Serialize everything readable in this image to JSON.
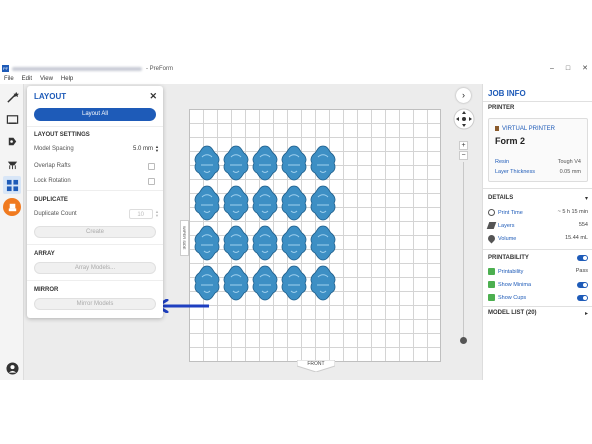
{
  "window": {
    "logo": "PF",
    "title": "- PreForm",
    "controls": [
      "–",
      "□",
      "✕"
    ]
  },
  "menu": [
    "File",
    "Edit",
    "View",
    "Help"
  ],
  "toolbar": {
    "tools": [
      "magic-wand-icon",
      "select-icon",
      "orient-icon",
      "supports-icon",
      "layout-icon",
      "print-icon",
      "account-icon"
    ]
  },
  "layout_panel": {
    "title": "LAYOUT",
    "close": "✕",
    "layout_all": "Layout All",
    "settings_heading": "LAYOUT SETTINGS",
    "model_spacing_label": "Model Spacing",
    "model_spacing_value": "5.0 mm",
    "overlap_rafts_label": "Overlap Rafts",
    "lock_rotation_label": "Lock Rotation",
    "duplicate_heading": "DUPLICATE",
    "duplicate_count_label": "Duplicate Count",
    "duplicate_count_value": "10",
    "create_label": "Create",
    "array_heading": "ARRAY",
    "array_models_label": "Array Models...",
    "mirror_heading": "MIRROR",
    "mirror_models_label": "Mirror Models"
  },
  "build_plate": {
    "wiper_label": "WIPER SIDE",
    "front_label": "FRONT",
    "model_rows": 4,
    "model_cols": 5,
    "model_color": "#3d8fc4"
  },
  "view_controls": {
    "next": "›",
    "zoom_in": "+",
    "zoom_out": "−",
    "zoom_level": 0
  },
  "job_info": {
    "title": "JOB INFO",
    "printer_heading": "PRINTER",
    "printer_tag": "VIRTUAL PRINTER",
    "printer_name": "Form 2",
    "resin_label": "Resin",
    "resin_value": "Tough V4",
    "layer_label": "Layer Thickness",
    "layer_value": "0.05 mm",
    "details_heading": "DETAILS",
    "print_time_label": "Print Time",
    "print_time_value": "~ 5 h 15 min",
    "layers_label": "Layers",
    "layers_value": "554",
    "volume_label": "Volume",
    "volume_value": "15.44 mL",
    "printability_heading": "PRINTABILITY",
    "printability_label": "Printability",
    "printability_value": "Pass",
    "show_minima_label": "Show Minima",
    "show_cups_label": "Show Cups",
    "model_list_heading": "MODEL LIST (20)",
    "accent": "#1e5bb8",
    "pass_color": "#4caf50"
  }
}
